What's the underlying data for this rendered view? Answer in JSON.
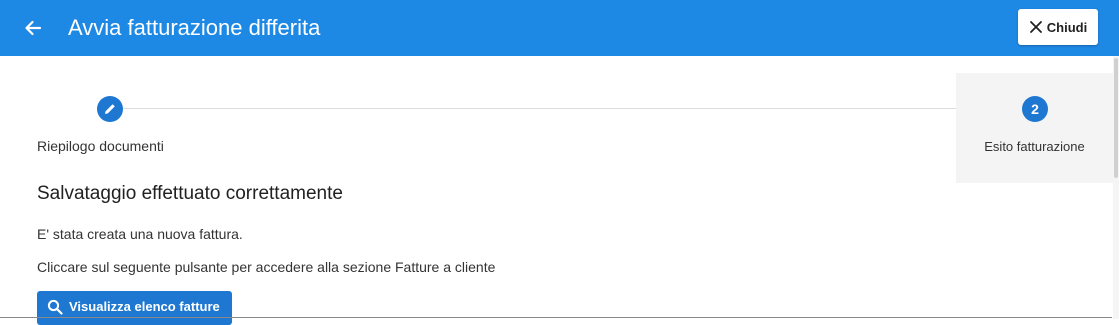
{
  "header": {
    "title": "Avvia fatturazione differita",
    "close_label": "Chiudi",
    "back_icon": "arrow-left-icon",
    "close_icon": "close-icon",
    "background_color": "#1e88e5"
  },
  "stepper": {
    "steps": [
      {
        "label": "Riepilogo documenti",
        "icon": "pencil-icon",
        "state": "completed"
      },
      {
        "label": "Esito fatturazione",
        "number": "2",
        "state": "active"
      }
    ],
    "accent_color": "#1e78d2"
  },
  "result": {
    "title": "Salvataggio effettuato correttamente",
    "message": "E' stata creata una nuova fattura.",
    "instruction": "Cliccare sul seguente pulsante per accedere alla sezione Fatture a cliente",
    "button_label": "Visualizza elenco fatture",
    "button_icon": "search-icon"
  }
}
